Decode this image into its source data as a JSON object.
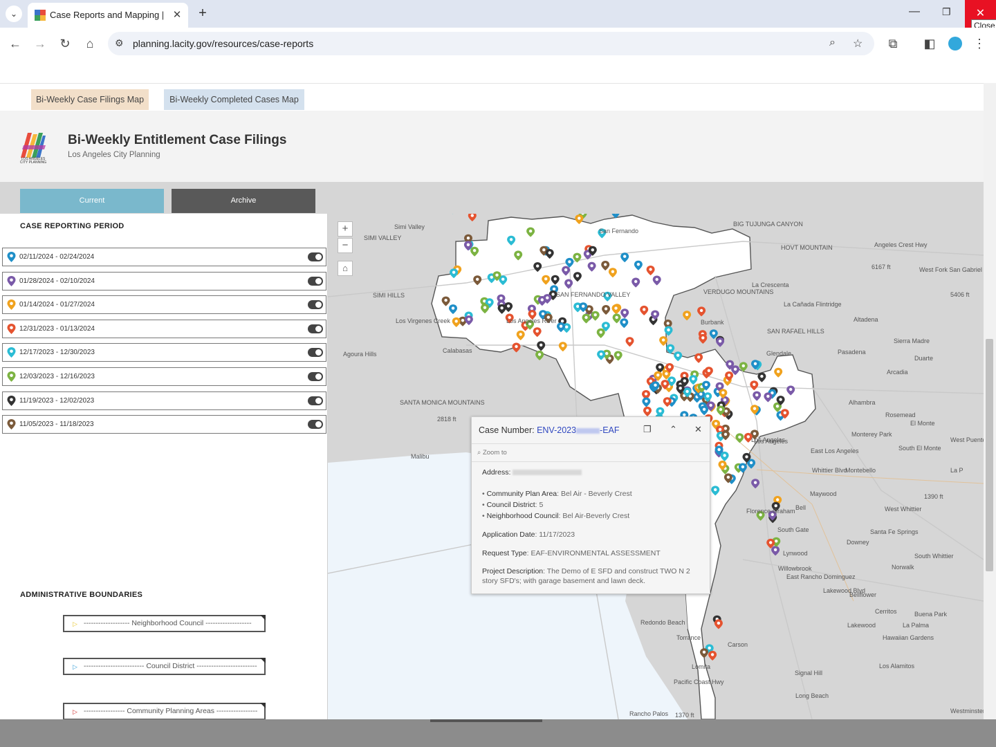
{
  "browser": {
    "tab_title": "Case Reports and Mapping | Lo",
    "url": "planning.lacity.gov/resources/case-reports",
    "tooltip": "Close"
  },
  "map_tabs": [
    {
      "label": "Bi-Weekly Case Filings Map"
    },
    {
      "label": "Bi-Weekly Completed Cases Map"
    }
  ],
  "header": {
    "logo_text": "LOS ANGELES CITY PLANNING",
    "title": "Bi-Weekly Entitlement Case Filings",
    "subtitle": "Los Angeles City Planning"
  },
  "buttons": {
    "current": "Current",
    "archive": "Archive"
  },
  "case_period": {
    "title": "CASE REPORTING PERIOD",
    "items": [
      {
        "label": "02/11/2024 - 02/24/2024",
        "color": "#1f8fc8"
      },
      {
        "label": "01/28/2024 - 02/10/2024",
        "color": "#7a5aa8"
      },
      {
        "label": "01/14/2024 - 01/27/2024",
        "color": "#f0a21e"
      },
      {
        "label": "12/31/2023 - 01/13/2024",
        "color": "#e5532f"
      },
      {
        "label": "12/17/2023 - 12/30/2023",
        "color": "#2bbcd4"
      },
      {
        "label": "12/03/2023 - 12/16/2023",
        "color": "#7cb342"
      },
      {
        "label": "11/19/2023 - 12/02/2023",
        "color": "#333333"
      },
      {
        "label": "11/05/2023 - 11/18/2023",
        "color": "#7b5a3a"
      }
    ]
  },
  "boundaries": {
    "title": "ADMINISTRATIVE BOUNDARIES",
    "items": [
      {
        "label": "------------------- Neighborhood Council -------------------",
        "color": "#e8c830"
      },
      {
        "label": "------------------------- Council District -------------------------",
        "color": "#3aa0d8"
      },
      {
        "label": "----------------- Community Planning Areas -----------------",
        "color": "#d03030"
      }
    ]
  },
  "map": {
    "labels": [
      "Simi Valley",
      "SIMI VALLEY",
      "SIMI HILLS",
      "Agoura Hills",
      "Calabasas",
      "SANTA MONICA MOUNTAINS",
      "2818 ft",
      "Malibu",
      "San Fernando",
      "SAN FERNANDO VALLEY",
      "Los Angeles River",
      "Burbank",
      "Glendale",
      "Pasadena",
      "Altadena",
      "La Cañada Flintridge",
      "La Crescenta",
      "VERDUGO MOUNTAINS",
      "SAN RAFAEL HILLS",
      "BIG TUJUNGA CANYON",
      "HOVT MOUNTAIN",
      "Angeles Crest Hwy",
      "6167 ft",
      "West Fork San Gabriel Ri",
      "5406 ft",
      "Sierra Madre",
      "Duarte",
      "Arcadia",
      "Alhambra",
      "Rosemead",
      "El Monte",
      "Monterey Park",
      "South El Monte",
      "West Puente Vall",
      "East Los Angeles",
      "Montebello",
      "La P",
      "Los Angeles",
      "Maywood",
      "Bell",
      "1390 ft",
      "West Whittier",
      "Florence-Graham",
      "South Gate",
      "Santa Fe Springs",
      "Downey",
      "Lynwood",
      "South Whittier",
      "Willowbrook",
      "Norwalk",
      "East Rancho Dominguez",
      "Bellflower",
      "Cerritos",
      "Buena Park",
      "Lakewood",
      "La Palma",
      "Hawaiian Gardens",
      "Redondo Beach",
      "Torrance",
      "Carson",
      "Lomita",
      "Signal Hill",
      "Los Alamitos",
      "Long Beach",
      "Rancho Palos",
      "1370 ft",
      "Westminster",
      "Los Virgenes Creek",
      "Whittier Blvd",
      "Lakewood Blvd",
      "Pacific Coast Hwy",
      "Los Angeles"
    ]
  },
  "popup": {
    "case_prefix": "Case Number: ",
    "case_number": "ENV-2023",
    "case_suffix": "-EAF",
    "zoom_to": "Zoom to",
    "address_label": "Address: ",
    "community_label": "Community Plan Area",
    "community_value": ": Bel Air - Beverly Crest",
    "council_label": "Council District",
    "council_value": ": 5",
    "neighborhood_label": "Neighborhood Council",
    "neighborhood_value": ": Bel Air-Beverly Crest",
    "app_date_label": "Application Date",
    "app_date_value": ": 11/17/2023",
    "request_label": "Request Type",
    "request_value": ": EAF-ENVIRONMENTAL ASSESSMENT",
    "desc_label": "Project Description",
    "desc_value": ": The Demo of E SFD and construct TWO N 2 story SFD's; with garage basement and lawn deck."
  }
}
